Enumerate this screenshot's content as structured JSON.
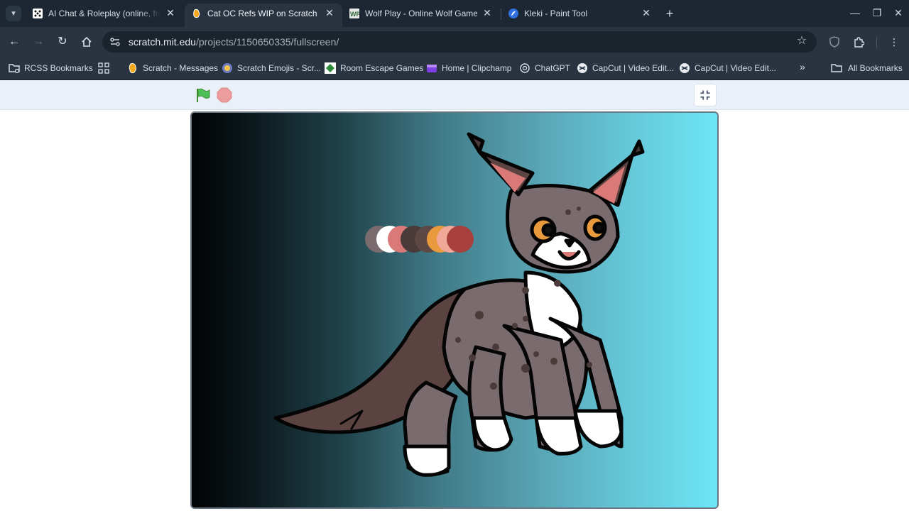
{
  "tabs": [
    {
      "title": "AI Chat & Roleplay (online, free",
      "active": false,
      "favicon": "dice-icon"
    },
    {
      "title": "Cat OC Refs WIP on Scratch",
      "active": true,
      "favicon": "scratch-icon"
    },
    {
      "title": "Wolf Play - Online Wolf Game!",
      "active": false,
      "favicon": "wp-icon"
    },
    {
      "title": "Kleki - Paint Tool",
      "active": false,
      "favicon": "kleki-icon"
    }
  ],
  "toolbar": {
    "url_host": "scratch.mit.edu",
    "url_path": "/projects/1150650335/fullscreen/"
  },
  "bookmarks": [
    {
      "label": "RCSS Bookmarks",
      "icon": "folder-icon"
    },
    {
      "label": "",
      "icon": "apps-grid-icon"
    },
    {
      "label": "Scratch - Messages",
      "icon": "scratch-icon"
    },
    {
      "label": "Scratch Emojis - Scr...",
      "icon": "scratch-emoji-icon"
    },
    {
      "label": "Room Escape Games",
      "icon": "room-escape-icon"
    },
    {
      "label": "Home | Clipchamp",
      "icon": "clipchamp-icon"
    },
    {
      "label": "ChatGPT",
      "icon": "chatgpt-icon"
    },
    {
      "label": "CapCut | Video Edit...",
      "icon": "capcut-icon"
    },
    {
      "label": "CapCut | Video Edit...",
      "icon": "capcut-icon"
    }
  ],
  "all_bookmarks_label": "All Bookmarks",
  "colors": {
    "tab_strip": "#1d2733",
    "toolbar": "#2a3441",
    "scratch_controls": "#e9f0f8",
    "palette": [
      "#7a6b6e",
      "#ffffff",
      "#d97a78",
      "#4a3a3a",
      "#5e4846",
      "#e89a3c",
      "#f0a898",
      "#a8403e"
    ]
  }
}
